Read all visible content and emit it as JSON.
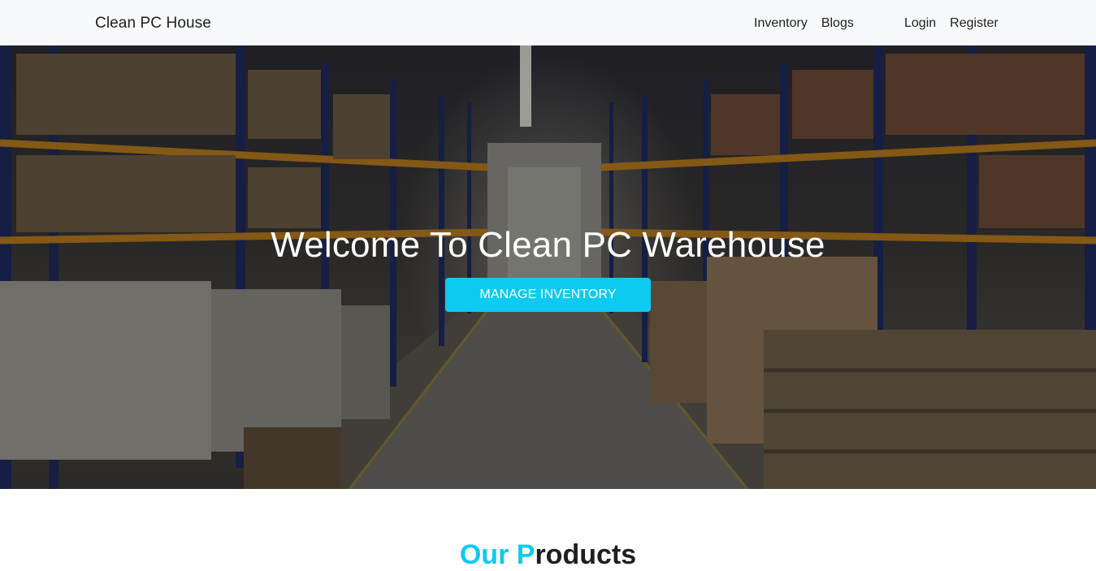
{
  "navbar": {
    "brand": "Clean PC House",
    "links_left": [
      "Inventory",
      "Blogs"
    ],
    "links_right": [
      "Login",
      "Register"
    ]
  },
  "hero": {
    "title": "Welcome To Clean PC Warehouse",
    "button_label": "MANAGE INVENTORY",
    "image": "warehouse-aisle-photo"
  },
  "section": {
    "title_accent": "Our P",
    "title_rest": "roducts"
  },
  "colors": {
    "accent": "#0dcaf0",
    "navbar_bg": "#f8f9fa"
  }
}
